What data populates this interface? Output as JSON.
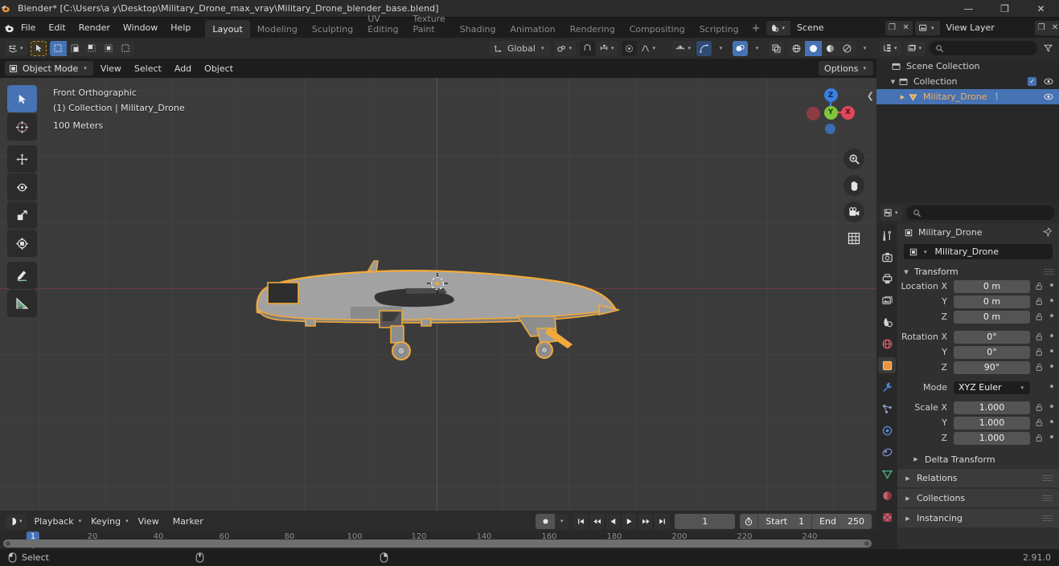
{
  "window": {
    "title": "Blender* [C:\\Users\\a y\\Desktop\\Military_Drone_max_vray\\Military_Drone_blender_base.blend]",
    "minimize": "—",
    "maximize": "❐",
    "close": "✕"
  },
  "menu": {
    "items": [
      "File",
      "Edit",
      "Render",
      "Window",
      "Help"
    ]
  },
  "workspace_tabs": [
    {
      "label": "Layout",
      "active": true
    },
    {
      "label": "Modeling",
      "active": false
    },
    {
      "label": "Sculpting",
      "active": false
    },
    {
      "label": "UV Editing",
      "active": false
    },
    {
      "label": "Texture Paint",
      "active": false
    },
    {
      "label": "Shading",
      "active": false
    },
    {
      "label": "Animation",
      "active": false
    },
    {
      "label": "Rendering",
      "active": false
    },
    {
      "label": "Compositing",
      "active": false
    },
    {
      "label": "Scripting",
      "active": false
    }
  ],
  "workspace_add": "+",
  "topbar": {
    "scene_name": "Scene",
    "view_layer_name": "View Layer",
    "new_glyph": "❐",
    "close_glyph": "✕"
  },
  "viewport_header": {
    "editor_type": "3d-viewport-icon",
    "transform_orientation": "Global",
    "options_label": "Options"
  },
  "mode_bar": {
    "mode": "Object Mode",
    "menus": [
      "View",
      "Select",
      "Add",
      "Object"
    ]
  },
  "viewport": {
    "view_name": "Front Orthographic",
    "collection_object": "(1) Collection | Military_Drone",
    "scale_info": "100 Meters",
    "gizmo_axes": [
      {
        "label": "Z",
        "color": "#3b7fe0"
      },
      {
        "label": "Y",
        "color": "#7fc63a"
      },
      {
        "label": "X",
        "color": "#e0485a"
      }
    ],
    "tools": [
      {
        "name": "tweak-tool",
        "active": true
      },
      {
        "name": "cursor-tool",
        "active": false
      },
      {
        "name": "move-tool",
        "active": false
      },
      {
        "name": "rotate-tool",
        "active": false
      },
      {
        "name": "scale-tool",
        "active": false
      },
      {
        "name": "transform-tool",
        "active": false
      },
      {
        "name": "annotate-tool",
        "active": false
      },
      {
        "name": "measure-tool",
        "active": false
      }
    ],
    "nav_buttons": [
      "zoom-icon",
      "pan-hand-icon",
      "camera-icon",
      "grid-ortho-icon"
    ],
    "selection_outline_color": "#f2a93b",
    "object_color": "#a0a0a0",
    "background_color": "#3b3b3b"
  },
  "outliner": {
    "search_placeholder": "",
    "rows": [
      {
        "label": "Scene Collection",
        "depth": 0,
        "icon": "collection-icon",
        "expander": "",
        "selected": false,
        "has_checkbox": false,
        "has_eye": false
      },
      {
        "label": "Collection",
        "depth": 1,
        "icon": "collection-icon",
        "expander": "▼",
        "selected": false,
        "has_checkbox": true,
        "has_eye": true
      },
      {
        "label": "Military_Drone",
        "depth": 2,
        "icon": "mesh-object-icon",
        "expander": "▶",
        "selected": true,
        "has_checkbox": false,
        "has_eye": true
      }
    ]
  },
  "properties": {
    "search_placeholder": "",
    "breadcrumb_object": "Military_Drone",
    "object_name_field": "Military_Drone",
    "tabs": [
      {
        "name": "tool-tab",
        "glyph": "🔧",
        "active": false
      },
      {
        "name": "render-tab",
        "glyph": "📷",
        "active": false
      },
      {
        "name": "output-tab",
        "glyph": "🖨",
        "active": false
      },
      {
        "name": "view-layer-tab",
        "glyph": "🖼",
        "active": false
      },
      {
        "name": "scene-tab",
        "glyph": "◑",
        "active": false
      },
      {
        "name": "world-tab",
        "glyph": "🌐",
        "active": false
      },
      {
        "name": "object-tab",
        "glyph": "▣",
        "active": true
      },
      {
        "name": "modifier-tab",
        "glyph": "🔧",
        "active": false
      },
      {
        "name": "particles-tab",
        "glyph": "✵",
        "active": false
      },
      {
        "name": "physics-tab",
        "glyph": "◎",
        "active": false
      },
      {
        "name": "constraints-tab",
        "glyph": "⛓",
        "active": false
      },
      {
        "name": "data-tab",
        "glyph": "▽",
        "active": false
      },
      {
        "name": "material-tab",
        "glyph": "◕",
        "active": false
      },
      {
        "name": "texture-tab",
        "glyph": "▓",
        "active": false
      }
    ],
    "transform": {
      "panel_label": "Transform",
      "rows": [
        {
          "label": "Location X",
          "value": "0 m",
          "type": "num"
        },
        {
          "label": "Y",
          "value": "0 m",
          "type": "num"
        },
        {
          "label": "Z",
          "value": "0 m",
          "type": "num"
        },
        {
          "label": "Rotation X",
          "value": "0°",
          "type": "num"
        },
        {
          "label": "Y",
          "value": "0°",
          "type": "num"
        },
        {
          "label": "Z",
          "value": "90°",
          "type": "num"
        },
        {
          "label": "Mode",
          "value": "XYZ Euler",
          "type": "select"
        },
        {
          "label": "Scale X",
          "value": "1.000",
          "type": "num"
        },
        {
          "label": "Y",
          "value": "1.000",
          "type": "num"
        },
        {
          "label": "Z",
          "value": "1.000",
          "type": "num"
        }
      ],
      "sub_panel": "Delta Transform"
    },
    "closed_panels": [
      "Relations",
      "Collections",
      "Instancing"
    ]
  },
  "timeline": {
    "menus": [
      "Playback",
      "Keying",
      "View",
      "Marker"
    ],
    "playback_glyphs": [
      "⏮",
      "⏪",
      "◀",
      "▶",
      "⏩",
      "⏭"
    ],
    "current_frame": "1",
    "start_label": "Start",
    "start_value": "1",
    "end_label": "End",
    "end_value": "250",
    "ticks": [
      "20",
      "40",
      "60",
      "80",
      "100",
      "120",
      "140",
      "160",
      "180",
      "200",
      "220",
      "240"
    ],
    "playhead_frame": "1"
  },
  "statusbar": {
    "left_action": "Select",
    "version": "2.91.0"
  }
}
